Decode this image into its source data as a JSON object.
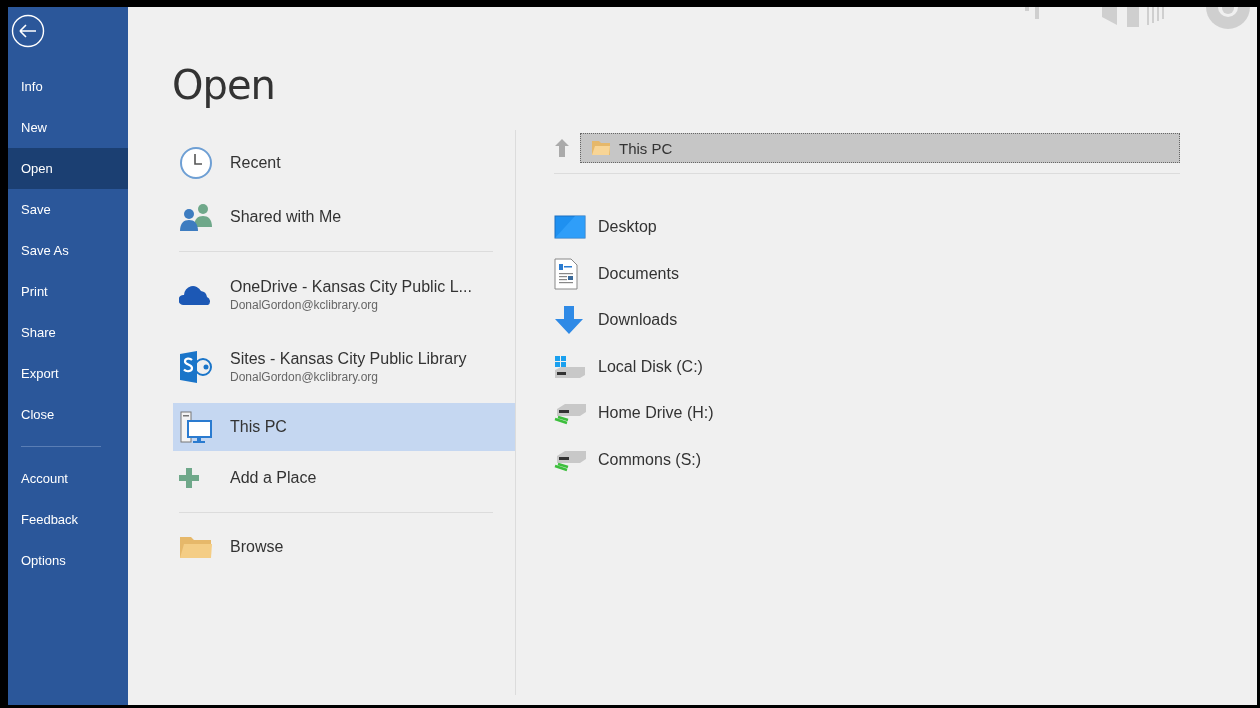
{
  "nav": {
    "items": [
      {
        "label": "Info",
        "selected": false
      },
      {
        "label": "New",
        "selected": false
      },
      {
        "label": "Open",
        "selected": true
      },
      {
        "label": "Save",
        "selected": false
      },
      {
        "label": "Save As",
        "selected": false
      },
      {
        "label": "Print",
        "selected": false
      },
      {
        "label": "Share",
        "selected": false
      },
      {
        "label": "Export",
        "selected": false
      },
      {
        "label": "Close",
        "selected": false
      }
    ],
    "bottom_items": [
      {
        "label": "Account",
        "selected": false
      },
      {
        "label": "Feedback",
        "selected": false
      },
      {
        "label": "Options",
        "selected": false
      }
    ]
  },
  "title": "Open",
  "place_groups": [
    {
      "items": [
        {
          "kind": "recent",
          "label": "Recent",
          "selected": false
        },
        {
          "kind": "shared",
          "label": "Shared with Me",
          "selected": false
        }
      ]
    },
    {
      "items": [
        {
          "kind": "onedrive",
          "label": "OneDrive - Kansas City Public L...",
          "account": "DonalGordon@kclibrary.org",
          "selected": false
        },
        {
          "kind": "sites",
          "label": "Sites - Kansas City Public Library",
          "account": "DonalGordon@kclibrary.org",
          "selected": false
        },
        {
          "kind": "computer",
          "label": "This PC",
          "selected": true
        },
        {
          "kind": "add",
          "label": "Add a Place",
          "selected": false
        }
      ]
    },
    {
      "items": [
        {
          "kind": "browse",
          "label": "Browse",
          "selected": false
        }
      ]
    }
  ],
  "location": {
    "path": "This PC"
  },
  "folders": [
    {
      "kind": "desktop",
      "name": "Desktop"
    },
    {
      "kind": "documents",
      "name": "Documents"
    },
    {
      "kind": "downloads",
      "name": "Downloads"
    },
    {
      "kind": "system_disk",
      "name": "Local Disk (C:)"
    },
    {
      "kind": "network_drive",
      "name": "Home Drive (H:)"
    },
    {
      "kind": "network_drive",
      "name": "Commons (S:)"
    }
  ]
}
